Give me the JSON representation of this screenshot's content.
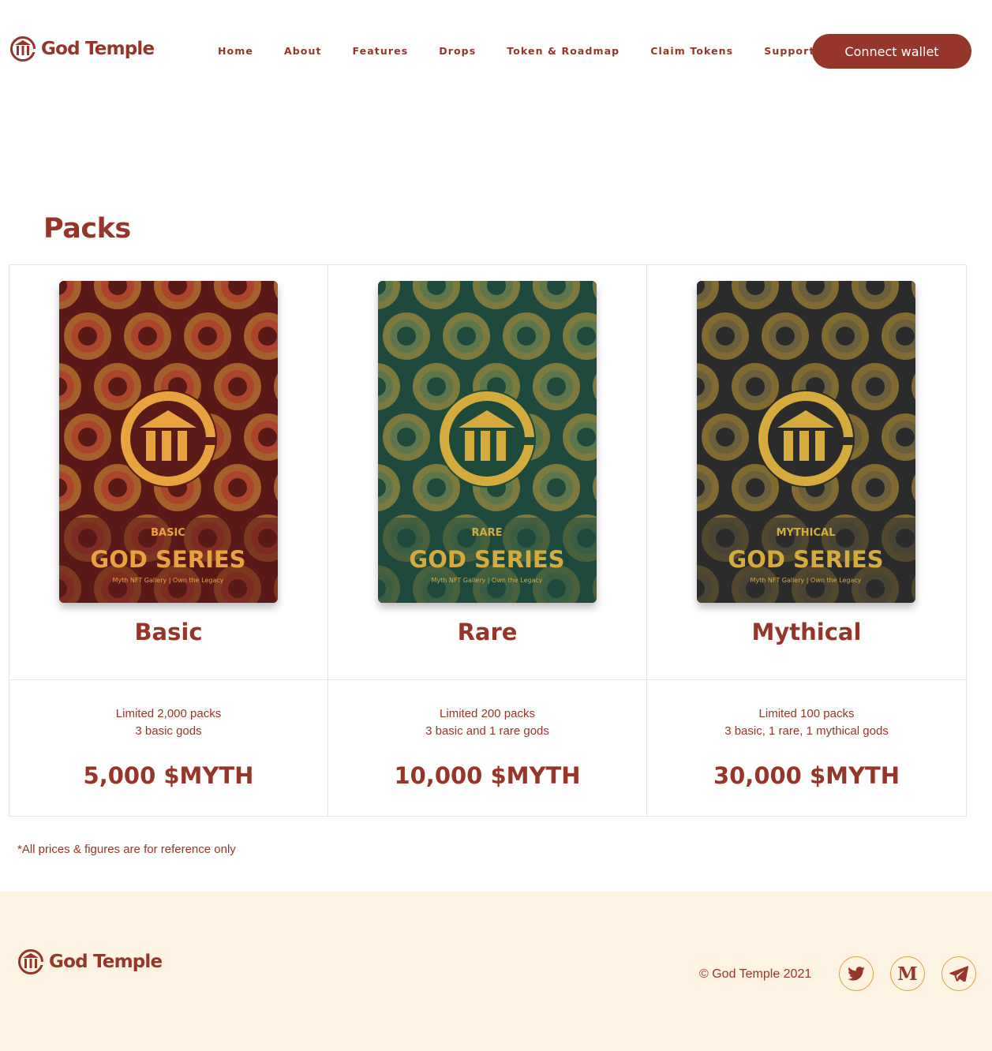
{
  "header": {
    "brand": "God Temple",
    "nav": [
      "Home",
      "About",
      "Features",
      "Drops",
      "Token & Roadmap",
      "Claim Tokens",
      "Support"
    ],
    "connect_button": "Connect wallet"
  },
  "packs_section": {
    "title": "Packs",
    "packs": [
      {
        "name": "Basic",
        "tier_label": "BASIC",
        "series_label": "GOD SERIES",
        "tagline": "Myth NFT Gallery  |  Own the Legacy",
        "limit": "Limited 2,000 packs",
        "contents": "3 basic gods",
        "price": "5,000 $MYTH",
        "colors": {
          "bg": "#5a1a17",
          "ring_outer": "#e59a3e",
          "ring_mid": "#d9573a",
          "ring_inner": "#5a1a17",
          "text": "#e8a33e"
        }
      },
      {
        "name": "Rare",
        "tier_label": "RARE",
        "series_label": "GOD SERIES",
        "tagline": "Myth NFT Gallery  |  Own the Legacy",
        "limit": "Limited 200 packs",
        "contents": "3 basic and 1 rare gods",
        "price": "10,000 $MYTH",
        "colors": {
          "bg": "#1e4a3c",
          "ring_outer": "#c9a33e",
          "ring_mid": "#7b8d54",
          "ring_inner": "#1e4a3c",
          "text": "#d6ab3d"
        }
      },
      {
        "name": "Mythical",
        "tier_label": "MYTHICAL",
        "series_label": "GOD SERIES",
        "tagline": "Myth NFT Gallery  |  Own the Legacy",
        "limit": "Limited 100 packs",
        "contents": "3 basic, 1 rare, 1 mythical gods",
        "price": "30,000 $MYTH",
        "colors": {
          "bg": "#2b2b2b",
          "ring_outer": "#c9a036",
          "ring_mid": "#8a7a45",
          "ring_inner": "#2b2b2b",
          "text": "#d6ab3d"
        }
      }
    ],
    "footnote": "*All prices & figures are for reference only"
  },
  "footer": {
    "brand": "God Temple",
    "copyright": "© God Temple 2021",
    "social": [
      "twitter-icon",
      "medium-icon",
      "telegram-icon"
    ],
    "medium_glyph": "M"
  },
  "colors": {
    "brand": "#963529",
    "footer_bg": "#fdf3e3",
    "social_ring": "#d9a23a"
  }
}
